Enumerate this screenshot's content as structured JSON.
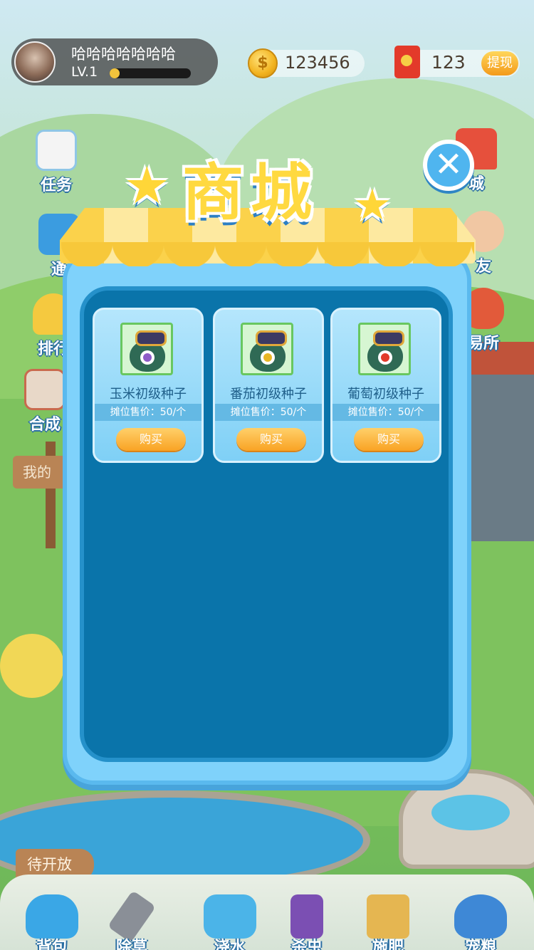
{
  "player": {
    "name": "哈哈哈哈哈哈哈",
    "level": "LV.1",
    "xp_progress": 0.05
  },
  "currency": {
    "coins": "123456",
    "coin_symbol": "$",
    "red_packets": "123",
    "withdraw_label": "提现"
  },
  "side_left": [
    {
      "label": "任务",
      "icon": "task-clipboard-icon"
    },
    {
      "label": "通",
      "icon": "horn-icon"
    },
    {
      "label": "排行",
      "icon": "trophy-icon"
    },
    {
      "label": "合成",
      "icon": "merge-icon"
    }
  ],
  "side_right": [
    {
      "label": "城",
      "icon": "shop-stall-icon"
    },
    {
      "label": "友",
      "icon": "friend-avatar-icon"
    },
    {
      "label": "易所",
      "icon": "money-bag-icon"
    }
  ],
  "scene": {
    "farm_sign": "我的",
    "open_sign": "待开放"
  },
  "shop": {
    "title": "商城",
    "close_icon": "close-icon",
    "items": [
      {
        "name": "玉米初级种子",
        "price": "摊位售价：50/个",
        "buy_label": "购买",
        "seed_color": "#8e5bc8"
      },
      {
        "name": "番茄初级种子",
        "price": "摊位售价：50/个",
        "buy_label": "购买",
        "seed_color": "#e8b624"
      },
      {
        "name": "葡萄初级种子",
        "price": "摊位售价：50/个",
        "buy_label": "购买",
        "seed_color": "#e23a2a"
      }
    ]
  },
  "toolbar": [
    {
      "label": "背包",
      "icon": "backpack-icon",
      "color": "#3aa7e6"
    },
    {
      "label": "除草",
      "icon": "shovel-icon",
      "color": "#8a8f97"
    },
    {
      "label": "浇水",
      "icon": "watering-can-icon",
      "color": "#4bb4e8"
    },
    {
      "label": "杀虫",
      "icon": "pesticide-bottle-icon",
      "color": "#7b4fb3"
    },
    {
      "label": "施肥",
      "icon": "fertilizer-bag-icon",
      "color": "#e5b651"
    },
    {
      "label": "宠粮",
      "icon": "pet-food-bowl-icon",
      "color": "#3e88d6"
    }
  ]
}
